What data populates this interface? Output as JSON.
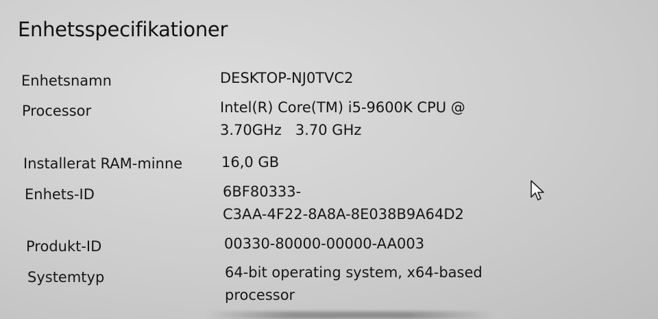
{
  "section": {
    "title": "Enhetsspecifikationer"
  },
  "specs": {
    "device_name": {
      "label": "Enhetsnamn",
      "value_lines": [
        "DESKTOP-NJ0TVC2"
      ]
    },
    "processor": {
      "label": "Processor",
      "value_lines": [
        "Intel(R) Core(TM) i5-9600K CPU @",
        "3.70GHz   3.70 GHz"
      ]
    },
    "ram": {
      "label": "Installerat RAM-minne",
      "value_lines": [
        "16,0 GB"
      ]
    },
    "device_id": {
      "label": "Enhets-ID",
      "value_lines": [
        "6BF80333-",
        "C3AA-4F22-8A8A-8E038B9A64D2"
      ]
    },
    "product_id": {
      "label": "Produkt-ID",
      "value_lines": [
        "00330-80000-00000-AA003"
      ]
    },
    "system_type": {
      "label": "Systemtyp",
      "value_lines": [
        "64-bit operating system, x64-based",
        "processor"
      ]
    }
  },
  "icons": {
    "cursor": "mouse-pointer-icon"
  }
}
